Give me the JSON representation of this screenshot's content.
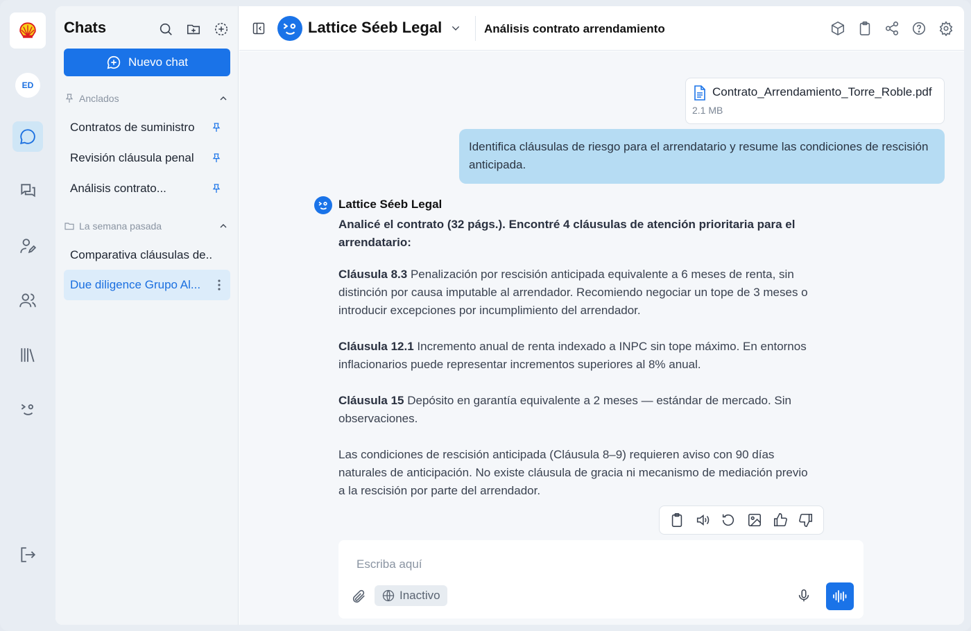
{
  "rail": {
    "avatar_initials": "ED",
    "icons": [
      "shell-logo-icon",
      "chat-icon",
      "conversations-icon",
      "user-edit-icon",
      "users-icon",
      "library-icon",
      "assistant-face-icon",
      "logout-icon"
    ]
  },
  "sidebar": {
    "title": "Chats",
    "new_chat_label": "Nuevo chat",
    "pinned_section": "Anclados",
    "pinned_items": [
      {
        "label": "Contratos de suministro"
      },
      {
        "label": "Revisión cláusula penal"
      },
      {
        "label": "Análisis contrato..."
      }
    ],
    "week_section": "La semana pasada",
    "week_items": [
      {
        "label": "Comparativa cláusulas de..."
      },
      {
        "label": "Due diligence Grupo Al..."
      }
    ]
  },
  "header": {
    "assistant_name": "Lattice Séeb Legal",
    "chat_title": "Análisis contrato arrendamiento"
  },
  "conversation": {
    "attachment": {
      "file_name": "Contrato_Arrendamiento_Torre_Roble.pdf",
      "file_size": "2.1 MB"
    },
    "user_message": "Identifica cláusulas de riesgo para el arrendatario y resume las condiciones de rescisión anticipada.",
    "bot_name": "Lattice Séeb Legal",
    "answer": {
      "intro": "Analicé el contrato (32 págs.). Encontré 4 cláusulas de atención prioritaria para el arrendatario:",
      "clauses": [
        {
          "ref": "Cláusula 8.3",
          "text": " Penalización por rescisión anticipada equivalente a 6 meses de renta, sin distinción por causa imputable al arrendador. Recomiendo negociar un tope de 3 meses o introducir excepciones por incumplimiento del arrendador."
        },
        {
          "ref": "Cláusula 12.1",
          "text": " Incremento anual de renta indexado a INPC sin tope máximo. En entornos inflacionarios puede representar incrementos superiores al 8% anual."
        },
        {
          "ref": "Cláusula 15",
          "text": " Depósito en garantía equivalente a 2 meses — estándar de mercado. Sin observaciones."
        }
      ],
      "closing": "Las condiciones de rescisión anticipada (Cláusula 8–9) requieren aviso con 90 días naturales de anticipación. No existe cláusula de gracia ni mecanismo de mediación previo a la rescisión por parte del arrendador."
    }
  },
  "composer": {
    "placeholder": "Escriba aquí",
    "web_search_label": "Inactivo"
  },
  "colors": {
    "accent": "#1a73e8",
    "user_bubble": "#b6dcf3",
    "selected_item_bg": "#dcecfa"
  }
}
